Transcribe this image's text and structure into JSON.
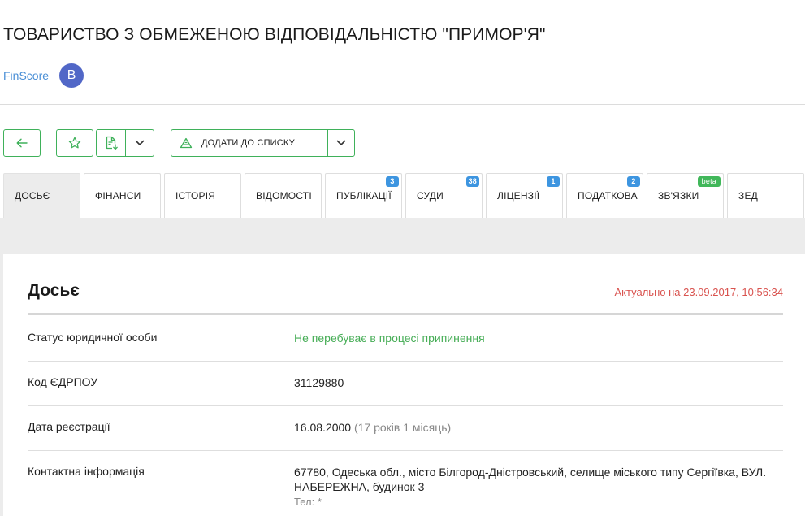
{
  "company": {
    "title": "ТОВАРИСТВО З ОБМЕЖЕНОЮ ВІДПОВІДАЛЬНІСТЮ \"ПРИМОР'Я\"",
    "finscore_label": "FinScore",
    "finscore_grade": "B"
  },
  "toolbar": {
    "add_to_list_label": "ДОДАТИ ДО СПИСКУ",
    "icons": [
      "arrow-left-icon",
      "star-icon",
      "file-download-icon",
      "chevron-down-icon",
      "add-list-icon",
      "chevron-down-icon"
    ]
  },
  "tabs": [
    {
      "label": "ДОСЬЄ",
      "active": true
    },
    {
      "label": "ФІНАНСИ"
    },
    {
      "label": "ІСТОРІЯ"
    },
    {
      "label": "ВІДОМОСТІ"
    },
    {
      "label": "ПУБЛІКАЦІЇ",
      "badge": "3"
    },
    {
      "label": "СУДИ",
      "badge": "38"
    },
    {
      "label": "ЛІЦЕНЗІЇ",
      "badge": "1"
    },
    {
      "label": "ПОДАТКОВА",
      "badge": "2"
    },
    {
      "label": "ЗВ'ЯЗКИ",
      "badge": "beta"
    },
    {
      "label": "ЗЕД"
    }
  ],
  "dossier": {
    "title": "Досьє",
    "updated": "Актуально на 23.09.2017, 10:56:34",
    "rows": [
      {
        "label": "Статус юридичної особи",
        "value": "Не перебуває в процесі припинення"
      },
      {
        "label": "Код ЄДРПОУ",
        "value": "31129880"
      },
      {
        "label": "Дата реєстрації",
        "value": "16.08.2000",
        "extra": "(17 років 1 місяць)"
      },
      {
        "label": "Контактна інформація",
        "value": "67780, Одеська обл., місто Білгород-Дністровський, селище міського типу Сергіївка, ВУЛ. НАБЕРЕЖНА, будинок 3",
        "phone": "Тел: *"
      }
    ]
  },
  "colors": {
    "accent_green": "#3fb15a",
    "badge_blue": "#3d95e0",
    "updated_red": "#d9534f",
    "status_green": "#46ad56",
    "finscore_badge": "#5167c7"
  }
}
